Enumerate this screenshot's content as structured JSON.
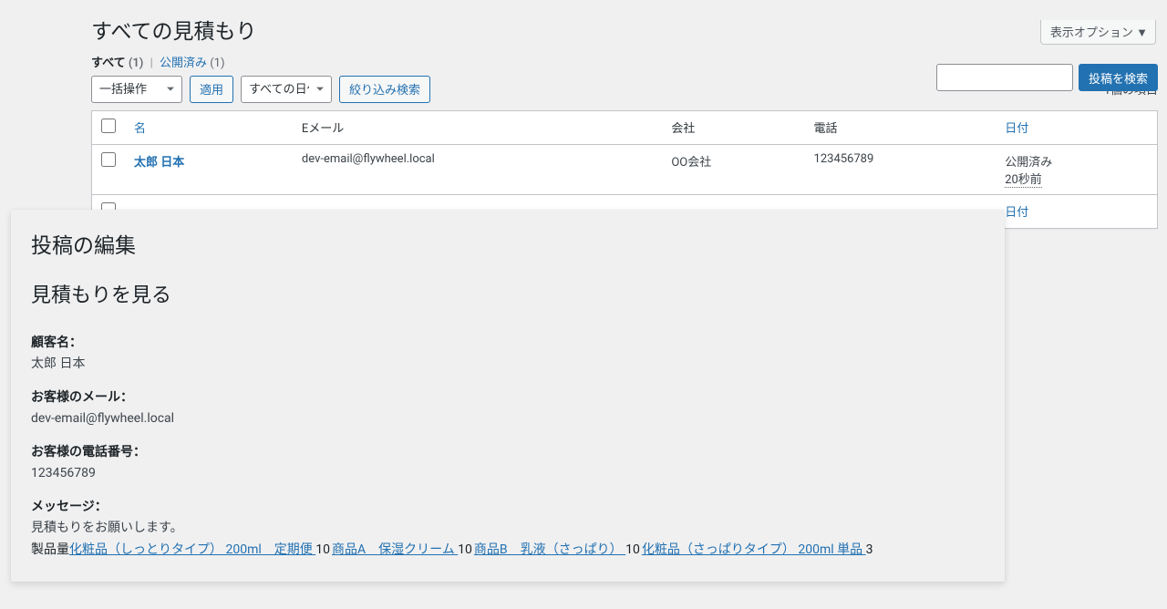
{
  "screen_options_label": "表示オプション ▼",
  "page_title": "すべての見積もり",
  "filters": {
    "all_label": "すべて",
    "all_count": "(1)",
    "published_label": "公開済み",
    "published_count": "(1)"
  },
  "bulk": {
    "select_label": "一括操作",
    "apply_label": "適用"
  },
  "date_filter": {
    "select_label": "すべての日付",
    "filter_button": "絞り込み検索"
  },
  "search": {
    "button_label": "投稿を検索",
    "value": ""
  },
  "items_count_label": "1個の項目",
  "columns": {
    "name": "名",
    "email": "Eメール",
    "company": "会社",
    "phone": "電話",
    "date": "日付"
  },
  "rows": [
    {
      "name": "太郎 日本",
      "email": "dev-email@flywheel.local",
      "company": "OO会社",
      "phone": "123456789",
      "date_status": "公開済み",
      "date_ago": "20秒前"
    }
  ],
  "edit": {
    "heading": "投稿の編集",
    "subheading": "見積もりを見る",
    "customer_name_label": "顧客名：",
    "customer_name_value": "太郎 日本",
    "email_label": "お客様のメール：",
    "email_value": "dev-email@flywheel.local",
    "phone_label": "お客様の電話番号：",
    "phone_value": "123456789",
    "message_label": "メッセージ：",
    "message_value": "見積もりをお願いします。",
    "products_prefix": "製品量",
    "products": [
      {
        "name": "化粧品（しっとりタイプ） 200ml　定期便 ",
        "qty": "10"
      },
      {
        "name": "商品A　保湿クリーム ",
        "qty": "10"
      },
      {
        "name": "商品B　乳液（さっぱり） ",
        "qty": "10"
      },
      {
        "name": "化粧品（さっぱりタイプ） 200ml 単品 ",
        "qty": "3"
      }
    ]
  }
}
